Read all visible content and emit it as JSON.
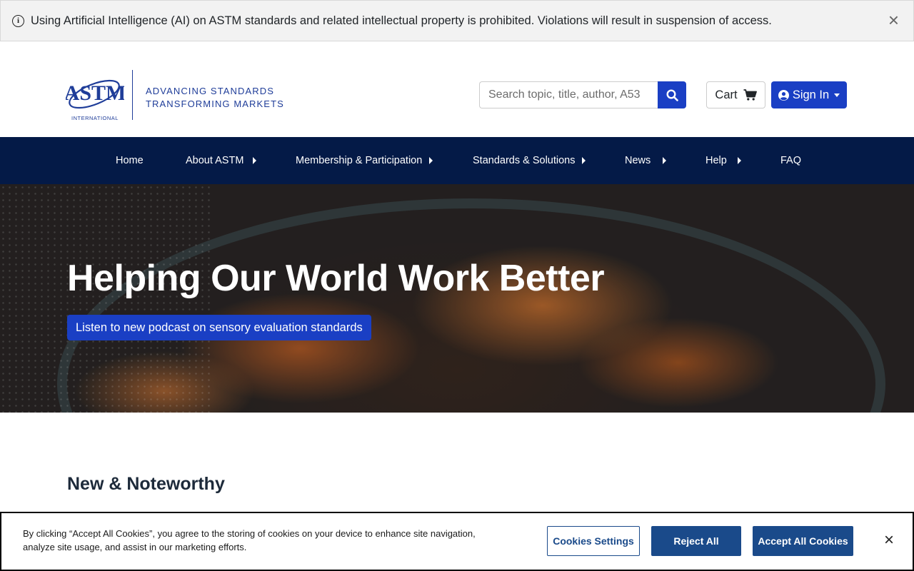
{
  "alert": {
    "text": "Using Artificial Intelligence (AI) on ASTM standards and related intellectual property is prohibited. Violations will result in suspension of access.",
    "close_label": "×"
  },
  "header": {
    "logo_text": "ASTM",
    "logo_sub": "INTERNATIONAL",
    "tagline_line1": "ADVANCING STANDARDS",
    "tagline_line2": "TRANSFORMING MARKETS",
    "search_placeholder": "Search topic, title, author, A53",
    "cart_label": "Cart",
    "signin_label": "Sign In"
  },
  "nav": {
    "items": [
      {
        "label": "Home",
        "has_submenu": false
      },
      {
        "label": "About ASTM",
        "has_submenu": true
      },
      {
        "label": "Membership & Participation",
        "has_submenu": true
      },
      {
        "label": "Standards & Solutions",
        "has_submenu": true
      },
      {
        "label": "News",
        "has_submenu": true
      },
      {
        "label": "Help",
        "has_submenu": true
      },
      {
        "label": "FAQ",
        "has_submenu": false
      }
    ]
  },
  "hero": {
    "title": "Helping Our World Work Better",
    "link_label": "Listen to new podcast on sensory evaluation standards"
  },
  "main": {
    "section_title": "New & Noteworthy"
  },
  "cookie": {
    "text": "By clicking “Accept All Cookies”, you agree to the storing of cookies on your device to enhance site navigation, analyze site usage, and assist in our marketing efforts.",
    "settings_label": "Cookies Settings",
    "reject_label": "Reject All",
    "accept_label": "Accept All Cookies",
    "close_label": "×"
  },
  "colors": {
    "brand_blue": "#1a3fc4",
    "nav_navy": "#041a47",
    "cookie_blue": "#1a4a8a"
  }
}
